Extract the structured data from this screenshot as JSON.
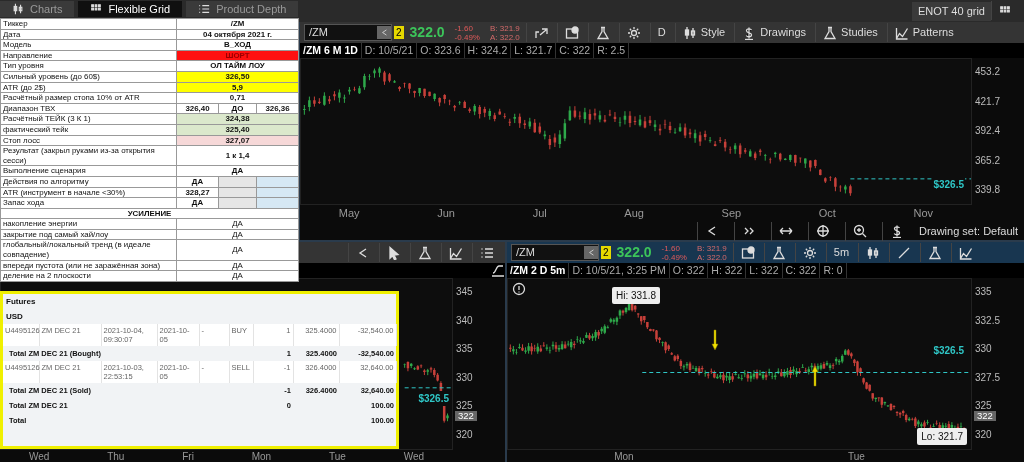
{
  "tabs": [
    {
      "label": "Charts",
      "selected": false
    },
    {
      "label": "Flexible Grid",
      "selected": true
    },
    {
      "label": "Product Depth",
      "selected": false
    }
  ],
  "grid_name": "ENOT 40 grid",
  "spreadsheet": {
    "rows": [
      {
        "kind": "value",
        "label": "Тиккер",
        "values": [
          "/ZM"
        ]
      },
      {
        "kind": "value",
        "label": "Дата",
        "values": [
          "04 октября 2021 г."
        ]
      },
      {
        "kind": "value",
        "label": "Модель",
        "values": [
          "В_ХОД"
        ]
      },
      {
        "kind": "value",
        "label": "Направление",
        "values": [
          "ШОРТ"
        ],
        "color": "#ff1010"
      },
      {
        "kind": "value",
        "label": "Тип уровня",
        "values": [
          "ОЛ ТАЙМ ЛОУ"
        ]
      },
      {
        "kind": "value",
        "label": "Сильный уровень (до 60$)",
        "values": [
          "326,50"
        ],
        "color": "#ffff00"
      },
      {
        "kind": "value",
        "label": "ATR  (до 2$)",
        "values": [
          "5,9"
        ],
        "color": "#ffff00"
      },
      {
        "kind": "value",
        "label": "Расчётный размер стопа 10% от ATR",
        "values": [
          "0,71"
        ]
      },
      {
        "kind": "split",
        "label": "Диапазон ТВХ",
        "values": [
          "326,40",
          "ДО",
          "326,36"
        ]
      },
      {
        "kind": "value",
        "label": "Расчётный ТЕЙК (3 К 1)",
        "values": [
          "324,38"
        ],
        "color": "#dbe8cc"
      },
      {
        "kind": "value",
        "label": "фактический тейк",
        "values": [
          "325,40"
        ],
        "color": "#dbe8cc"
      },
      {
        "kind": "value",
        "label": "Стоп лосс",
        "values": [
          "327,07"
        ],
        "color": "#f6d8d8"
      },
      {
        "kind": "value",
        "label": "Результат (закрыл руками из-за открытия сесси)",
        "values": [
          "1 к 1,4"
        ]
      },
      {
        "kind": "value",
        "label": "Выполнение сценария",
        "values": [
          "ДА"
        ]
      },
      {
        "kind": "partial",
        "label": "Действия по алгоритму",
        "values": [
          "ДА"
        ]
      },
      {
        "kind": "partial",
        "label": "ATR (инструмент в начале <30%)",
        "values": [
          "328,27"
        ]
      },
      {
        "kind": "partial",
        "label": "Запас хода",
        "values": [
          "ДА"
        ]
      },
      {
        "kind": "section",
        "label": "УСИЛЕНИЕ"
      },
      {
        "kind": "plain",
        "label": "накопление энергии",
        "values": [
          "ДА"
        ]
      },
      {
        "kind": "plain",
        "label": "закрытие под самый хай/лоу",
        "values": [
          "ДА"
        ]
      },
      {
        "kind": "plain",
        "label": "глобальный/локальный тренд (в идеале совпадение)",
        "values": [
          "ДА"
        ]
      },
      {
        "kind": "plain",
        "label": "впереди пустота (или не заражённая зона)",
        "values": [
          "ДА"
        ]
      },
      {
        "kind": "plain",
        "label": "деление на 2 плоскости",
        "values": [
          "ДА"
        ]
      }
    ]
  },
  "trades": {
    "rows": [
      {
        "kind": "group",
        "label": "Futures"
      },
      {
        "kind": "group",
        "label": "USD"
      },
      {
        "kind": "trade",
        "cells": [
          "U4495126",
          "ZM DEC 21",
          "2021-10-04, 09:30:07",
          "2021-10-05",
          "-",
          "BUY",
          "1",
          "325.4000",
          "-32,540.00"
        ]
      },
      {
        "kind": "subtotal",
        "label": "Total ZM DEC 21 (Bought)",
        "qty": "1",
        "price": "325.4000",
        "amount": "-32,540.00"
      },
      {
        "kind": "trade",
        "cells": [
          "U4495126",
          "ZM DEC 21",
          "2021-10-03, 22:53:15",
          "2021-10-05",
          "-",
          "SELL",
          "-1",
          "326.4000",
          "32,640.00"
        ]
      },
      {
        "kind": "subtotal",
        "label": "Total ZM DEC 21 (Sold)",
        "qty": "-1",
        "price": "326.4000",
        "amount": "32,640.00"
      },
      {
        "kind": "subtotal",
        "label": "Total ZM DEC 21",
        "qty": "0",
        "amount": "100.00"
      },
      {
        "kind": "subtotal",
        "label": "Total",
        "amount": "100.00"
      }
    ]
  },
  "top_chart": {
    "quote": {
      "symbol": "/ZM",
      "link": "2",
      "last": "322.0",
      "change": "-1.60",
      "change_pct": "-0.49%",
      "bid": "B: 321.9",
      "ask": "A: 322.0"
    },
    "toolbar": [
      "D",
      "Style",
      "Drawings",
      "Studies",
      "Patterns"
    ],
    "info": [
      "/ZM 6 M 1D",
      "D: 10/5/21",
      "O: 323.6",
      "H: 324.2",
      "L: 321.7",
      "C: 322",
      "R: 2.5"
    ],
    "y_labels": [
      "453.2",
      "421.7",
      "392.4",
      "365.2",
      "339.8"
    ],
    "x_labels": [
      "May",
      "Jun",
      "Jul",
      "Aug",
      "Sep",
      "Oct",
      "Nov"
    ],
    "price_label": "$326.5",
    "footer": "Drawing set: Default"
  },
  "left_chart": {
    "y_labels": [
      "345",
      "340",
      "335",
      "330",
      "325",
      "320"
    ],
    "price_label": "$326.5",
    "last_marker": "322",
    "x_labels": [
      "Wed",
      "Thu",
      "Fri",
      "Mon",
      "Tue",
      "Wed"
    ]
  },
  "right_chart": {
    "quote": {
      "symbol": "/ZM",
      "link": "2",
      "last": "322.0",
      "change": "-1.60",
      "change_pct": "-0.49%",
      "bid": "B: 321.9",
      "ask": "A: 322.0"
    },
    "toolbar": [
      "5m"
    ],
    "info": [
      "/ZM 2 D 5m",
      "D: 10/5/21, 3:25 PM",
      "O: 322",
      "H: 322",
      "L: 322",
      "C: 322",
      "R: 0"
    ],
    "y_labels": [
      "335",
      "332.5",
      "330",
      "327.5",
      "325",
      "320"
    ],
    "last_marker": "322",
    "x_labels": [
      "Mon",
      "Tue"
    ],
    "price_label": "$326.5",
    "high_label": "Hi: 331.8",
    "low_label": "Lo: 321.7"
  }
}
